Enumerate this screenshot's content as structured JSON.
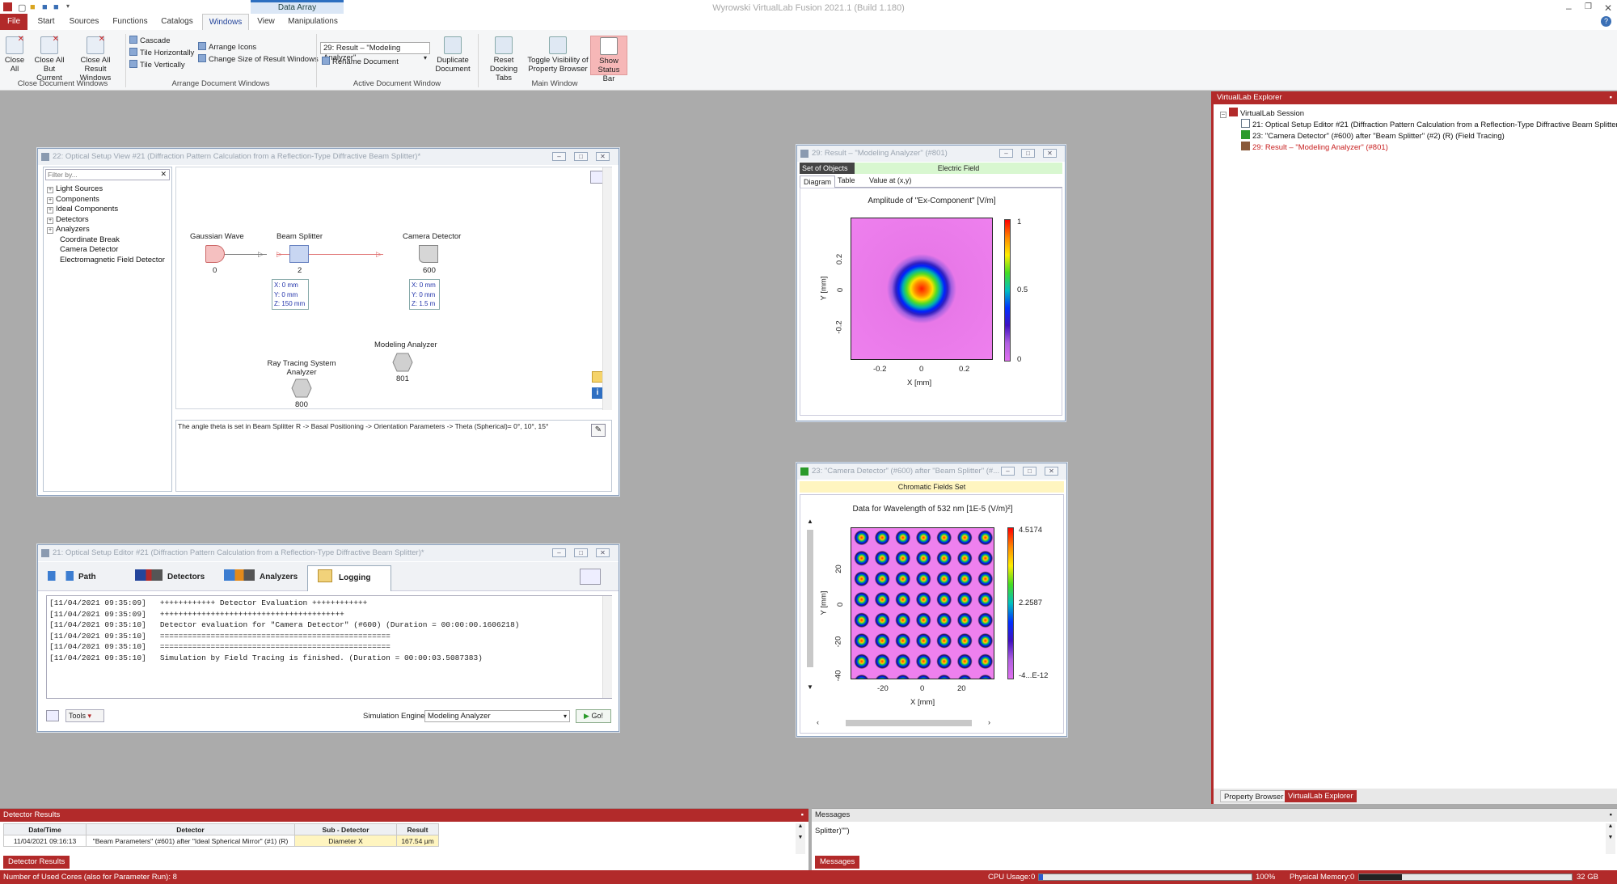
{
  "app": {
    "title": "Wyrowski VirtualLab Fusion 2021.1 (Build 1.180)",
    "context_tab": "Data Array"
  },
  "menu": [
    "File",
    "Start",
    "Sources",
    "Functions",
    "Catalogs",
    "Windows",
    "View",
    "Manipulations"
  ],
  "ribbon": {
    "close_all": "Close\nAll",
    "close_all_but_current": "Close All\nBut Current",
    "close_all_result": "Close All Result\nWindows",
    "cascade": "Cascade",
    "tile_h": "Tile Horizontally",
    "tile_v": "Tile Vertically",
    "arrange_icons": "Arrange Icons",
    "change_size": "Change Size of Result Windows",
    "doc_combo": "29: Result – \"Modeling Analyzer\"",
    "rename_doc": "Rename Document",
    "duplicate_doc": "Duplicate\nDocument",
    "reset_docking": "Reset\nDocking Tabs",
    "toggle_visibility": "Toggle Visibility of\nProperty Browser",
    "show_status": "Show\nStatus Bar",
    "groups": [
      "Close Document Windows",
      "Arrange Document Windows",
      "Active Document Window",
      "Main Window"
    ]
  },
  "setup_view": {
    "title": "22: Optical Setup View #21 (Diffraction Pattern Calculation from a Reflection-Type Diffractive Beam Splitter)*",
    "filter_placeholder": "Filter by...",
    "tree": [
      "Light Sources",
      "Components",
      "Ideal Components",
      "Detectors",
      "Analyzers",
      "Coordinate Break",
      "Camera Detector",
      "Electromagnetic Field Detector"
    ],
    "nodes": {
      "gaussian": {
        "name": "Gaussian Wave",
        "id": "0"
      },
      "splitter": {
        "name": "Beam Splitter",
        "id": "2",
        "pos": [
          "X: 0 mm",
          "Y: 0 mm",
          "Z: 150 mm"
        ]
      },
      "camera": {
        "name": "Camera Detector",
        "id": "600",
        "pos": [
          "X: 0 mm",
          "Y: 0 mm",
          "Z: 1.5 m"
        ]
      },
      "modeling": {
        "name": "Modeling Analyzer",
        "id": "801"
      },
      "raytrace": {
        "name": "Ray Tracing System\nAnalyzer",
        "id": "800"
      }
    },
    "note": "The angle theta is set in Beam Splitter R -> Basal Positioning -> Orientation Parameters -> Theta (Spherical)= 0°, 10°, 15°"
  },
  "editor": {
    "title": "21: Optical Setup Editor #21 (Diffraction Pattern Calculation from a Reflection-Type Diffractive Beam Splitter)*",
    "tabs": [
      "Path",
      "Detectors",
      "Analyzers",
      "Logging"
    ],
    "log": [
      "[11/04/2021 09:35:09]   ++++++++++++ Detector Evaluation ++++++++++++",
      "[11/04/2021 09:35:09]   ++++++++++++++++++++++++++++++++++++++++",
      "",
      "[11/04/2021 09:35:10]   Detector evaluation for \"Camera Detector\" (#600) (Duration = 00:00:00.1606218)",
      "",
      "[11/04/2021 09:35:10]   ==================================================",
      "[11/04/2021 09:35:10]   ==================================================",
      "[11/04/2021 09:35:10]   Simulation by Field Tracing is finished. (Duration = 00:00:03.5087383)"
    ],
    "tools": "Tools",
    "sim_engine_label": "Simulation Engine",
    "sim_engine_value": "Modeling Analyzer",
    "go": "Go!"
  },
  "result29": {
    "title": "29: Result – \"Modeling Analyzer\" (#801)",
    "set_of_objects": "Set of Objects",
    "electric_field": "Electric Field",
    "tabs": [
      "Diagram",
      "Table",
      "Value at (x,y)"
    ],
    "plot_title": "Amplitude of \"Ex-Component\"  [V/m]",
    "xlabel": "X [mm]",
    "ylabel": "Y [mm]",
    "xticks": [
      "-0.2",
      "0",
      "0.2"
    ],
    "yticks": [
      "0.2",
      "0",
      "-0.2"
    ],
    "cbar": [
      "1",
      "0.5",
      "0"
    ]
  },
  "result23": {
    "title": "23: \"Camera Detector\" (#600) after \"Beam Splitter\" (#...",
    "header": "Chromatic Fields Set",
    "plot_title": "Data for Wavelength of 532 nm  [1E-5 (V/m)²]",
    "xlabel": "X [mm]",
    "ylabel": "Y [mm]",
    "xticks": [
      "-20",
      "0",
      "20"
    ],
    "yticks": [
      "20",
      "0",
      "-20",
      "-40"
    ],
    "cbar": [
      "4.5174",
      "2.2587",
      "-4...E-12"
    ]
  },
  "explorer": {
    "title": "VirtualLab Explorer",
    "root": "VirtualLab Session",
    "items": [
      "21: Optical Setup Editor #21 (Diffraction Pattern Calculation from a Reflection-Type Diffractive Beam Splitter)*",
      "23: \"Camera Detector\" (#600) after \"Beam Splitter\" (#2) (R) (Field Tracing)",
      "29: Result – \"Modeling Analyzer\" (#801)"
    ],
    "tabs": [
      "Property Browser",
      "VirtualLab Explorer"
    ]
  },
  "detector_results": {
    "title": "Detector Results",
    "columns": [
      "Date/Time",
      "Detector",
      "Sub - Detector",
      "Result"
    ],
    "row": [
      "11/04/2021 09:16:13",
      "\"Beam Parameters\" (#601) after \"Ideal Spherical Mirror\" (#1) (R)",
      "Diameter X",
      "167.54 µm"
    ],
    "tab": "Detector Results"
  },
  "messages": {
    "title": "Messages",
    "text": "Splitter)\"\")",
    "tab": "Messages"
  },
  "status": {
    "cores": "Number of Used Cores (also for Parameter Run): 8",
    "cpu_label": "CPU Usage:",
    "cpu_min": "0",
    "cpu_max": "100%",
    "cpu_value": 0.02,
    "mem_label": "Physical Memory:",
    "mem_min": "0",
    "mem_max": "32 GB",
    "mem_value": 0.2
  },
  "colors": {
    "accent": "#b22a2a",
    "ribbon_blue": "#24459b",
    "highlight_green": "#d8f7d0",
    "highlight_yellow": "#fff5c0"
  }
}
